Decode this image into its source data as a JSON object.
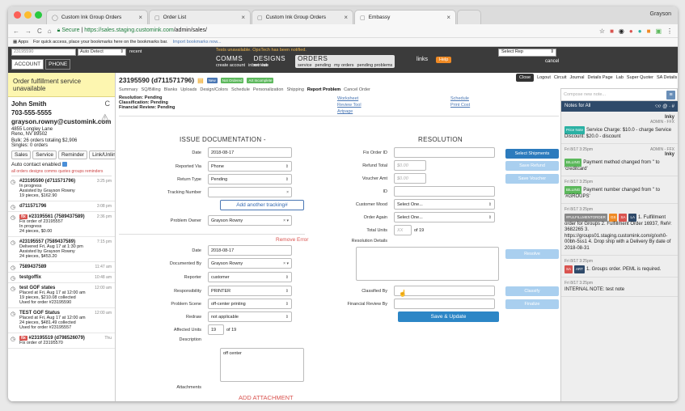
{
  "browser": {
    "tabs": [
      {
        "label": "Custom Ink Group Orders"
      },
      {
        "label": "Order List"
      },
      {
        "label": "Custom Ink Group Orders"
      },
      {
        "label": "Embassy"
      }
    ],
    "user": "Grayson",
    "secure": "Secure",
    "url_host": "https://sales.staging.customink.com",
    "url_path": "/admin/sales/",
    "bookmarks_apps": "Apps",
    "bookmarks_text": "For quick access, place your bookmarks here on the bookmarks bar.",
    "bookmarks_link": "Import bookmarks now..."
  },
  "appbar": {
    "search_value": "23195590",
    "detect": "Auto Detect",
    "recent": "recent",
    "account": "ACCOUNT",
    "phone": "PHONE",
    "warning": "Tests unavailable. OpsTech has been notified.",
    "comms": "COMMS",
    "comms_sub": [
      "create account",
      "inbox",
      "lab"
    ],
    "designs": "DESIGNS",
    "designs_sub": [
      "retrieve"
    ],
    "orders": "ORDERS",
    "orders_sub": [
      "service",
      "pending",
      "my orders",
      "pending problems"
    ],
    "links": "links",
    "help": "Help",
    "select_rep": "Select Rep",
    "cancel": "cancel"
  },
  "sidebar": {
    "alert": "Order fulfillment service unavailable",
    "name": "John Smith",
    "phone": "703-555-5555",
    "email": "grayson.rowny@customink.com",
    "addr1": "4855 Longley Lane",
    "addr2": "Reno, NV 89502",
    "bulk": "Bulk: 26 orders totaling $2,906",
    "singles": "Singles: 0 orders",
    "buttons": [
      "Sales",
      "Service",
      "Reminder",
      "Link/Unlink"
    ],
    "autocontact": "Auto contact enabled",
    "filters": "all  orders  designs  comms  quotes  groups  reminders",
    "orders": [
      {
        "title": "#23195590 (d711571796)",
        "time": "3:25 pm",
        "lines": [
          "In progress",
          "Assisted by Grayson Rowny",
          "19 pieces, $162.90"
        ]
      },
      {
        "title": "d711571796",
        "time": "3:08 pm",
        "lines": []
      },
      {
        "title": "#23195561 (7589437589)",
        "time": "2:36 pm",
        "tag": "fix",
        "lines": [
          "Fix order of 23195557",
          "In progress",
          "24 pieces, $0.00"
        ]
      },
      {
        "title": "#23195557 (7589437589)",
        "time": "7:15 pm",
        "lines": [
          "Delivered Fri, Aug 17 at 1:30 pm",
          "Assisted by Grayson Rowny",
          "24 pieces, $453.20"
        ]
      },
      {
        "title": "7589437589",
        "time": "11:47 am",
        "lines": []
      },
      {
        "title": "testgoffix",
        "time": "10:48 am",
        "lines": []
      },
      {
        "title": "test GOF states",
        "time": "12:00 am",
        "lines": [
          "Placed at Fri, Aug 17 at 12:00 am",
          "19 pieces, $210.08 collected",
          "Used for order #23195590"
        ]
      },
      {
        "title": "TEST GOF Status",
        "time": "12:00 am",
        "lines": [
          "Placed at Fri, Aug 17 at 12:00 am",
          "24 pieces, $481.49 collected",
          "Used for order #23195557"
        ]
      },
      {
        "title": "#23195519 (d798526079)",
        "time": "Thu",
        "tag": "fix",
        "lines": [
          "Fix order of 23195570"
        ]
      }
    ]
  },
  "order": {
    "title": "23195590 (d711571796)",
    "badges": [
      "New",
      "Not Ordered",
      "Art Incomplete"
    ],
    "subnav": [
      "Summary",
      "SQ/Billing",
      "Blanks",
      "Uploads",
      "Design/Colors",
      "Schedule",
      "Personalization",
      "Shipping",
      "Report Problem",
      "Cancel Order"
    ],
    "active_subnav": "Report Problem",
    "resolution": "Resolution: Pending",
    "classification": "Classification: Pending",
    "financial": "Financial Review: Pending",
    "links_mid": [
      "Worksheet",
      "Review Tool",
      "Artpage"
    ],
    "links_right": [
      "Schedule",
      "Print Cost"
    ],
    "toolbar": [
      "Close",
      "Logout",
      "Circuit",
      "Journal",
      "Details Page",
      "Lab",
      "Super Quoter",
      "SA Details"
    ]
  },
  "issue": {
    "heading": "ISSUE DOCUMENTATION -",
    "date_label": "Date",
    "date": "2018-08-17",
    "reported_label": "Reported Via",
    "reported": "Phone",
    "returntype_label": "Return Type",
    "returntype": "Pending",
    "tracking_label": "Tracking Number",
    "add_tracking": "Add another tracking#",
    "owner_label": "Problem Owner",
    "owner": "Grayson Rowny",
    "remove": "Remove Error",
    "date2_label": "Date",
    "date2": "2018-08-17",
    "docby_label": "Documented By",
    "docby": "Grayson Rowny",
    "reporter_label": "Reporter",
    "reporter": "customer",
    "resp_label": "Responsibility",
    "resp": "PRINTER",
    "scene_label": "Problem Scene",
    "scene": "off-center printing",
    "redraw_label": "Redraw",
    "redraw": "not applicable",
    "units_label": "Affected Units",
    "units": "19",
    "units_of": "of 19",
    "desc_label": "Description",
    "desc": "off center",
    "attach_label": "Attachments",
    "add_attachment": "ADD ATTACHMENT"
  },
  "resolution": {
    "heading": "RESOLUTION",
    "fixid_label": "Fix Order ID",
    "refund_label": "Refund Total",
    "refund_ph": "$0.00",
    "voucher_label": "Voucher Amt",
    "voucher_ph": "$0.00",
    "id_label": "ID",
    "mood_label": "Customer Mood",
    "mood": "Select One...",
    "again_label": "Order Again",
    "again": "Select One...",
    "total_label": "Total Units",
    "total_ph": "XX",
    "total_of": "of 19",
    "details_label": "Resolution Details",
    "classified_label": "Classified By",
    "finrev_label": "Financial Review By",
    "btn_shipments": "Select Shipments",
    "btn_refund": "Save Refund",
    "btn_voucher": "Save Voucher",
    "btn_resolve": "Resolve",
    "btn_classify": "Classify",
    "btn_finalize": "Finalize",
    "save": "Save & Update"
  },
  "notes": {
    "placeholder": "Compose new note...",
    "header": "Notes for All",
    "items": [
      {
        "time": "",
        "author": "Inky",
        "role": "ADMIN - FFX",
        "tags": [
          {
            "t": "Price Note",
            "c": "#2bb1a4"
          }
        ],
        "body": "Service Charge: $10.0 - charge Service Discount: $20.0 - discount"
      },
      {
        "time": "Fri 8/17 3:25pm",
        "author": "Inky",
        "role": "ADMIN - FFX",
        "tags": [
          {
            "t": "BILLING",
            "c": "#5cb85c"
          }
        ],
        "body": "Payment method changed from '' to 'creditcard'"
      },
      {
        "time": "Fri 8/17 3:25pm",
        "author": "",
        "role": "",
        "tags": [
          {
            "t": "BILLING",
            "c": "#5cb85c"
          }
        ],
        "body": "Payment number changed from '' to '#GROUPS'"
      },
      {
        "time": "Fri 8/17 3:25pm",
        "author": "",
        "role": "",
        "tags": [
          {
            "t": "#FULFILLMENTORDER",
            "c": "#888"
          },
          {
            "t": "GS",
            "c": "#f08a24"
          },
          {
            "t": "SA",
            "c": "#d9534f"
          },
          {
            "t": "LA",
            "c": "#2f4a6a"
          }
        ],
        "body": "1. Fulfillment order for Groups 2. Fulfillment Order 16937, Ref#: 3682265 3. https://groups01.staging.customink.com/g/xxh0-00bh-5ss1 4. Drop ship with a Delivery By date of 2018-08-31"
      },
      {
        "time": "Fri 8/17 3:25pm",
        "author": "",
        "role": "",
        "tags": [
          {
            "t": "SA",
            "c": "#d9534f"
          },
          {
            "t": "ART",
            "c": "#2f4a6a"
          }
        ],
        "body": "1. Groups order. PEML is required."
      },
      {
        "time": "Fri 8/17 3:25pm",
        "author": "",
        "role": "",
        "tags": [],
        "body": "INTERNAL NOTE: test note"
      }
    ]
  }
}
